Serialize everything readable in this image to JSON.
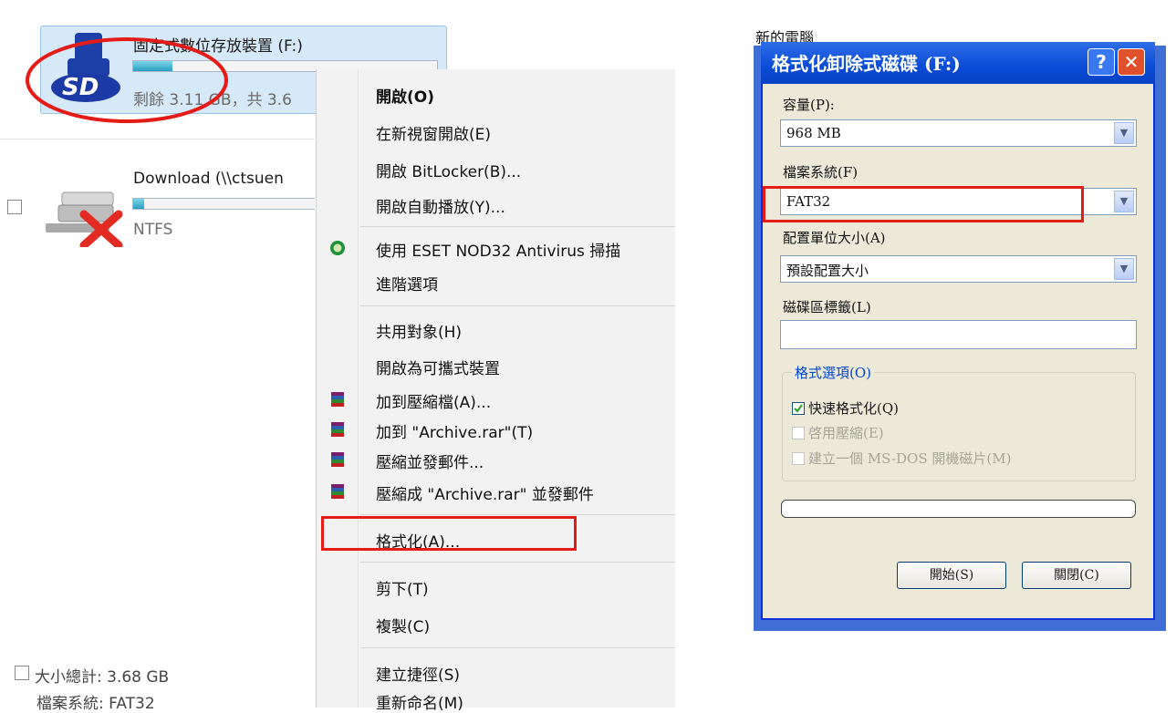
{
  "explorer": {
    "drive_sd": {
      "title": "固定式數位存放裝置 (F:)",
      "free_text": "剩餘 3.11 GB，共 3.6",
      "used_fraction": 0.13,
      "icon": "sd-card-icon"
    },
    "drive_network": {
      "title": "Download (\\\\ctsuen",
      "fs": "NTFS",
      "used_fraction": 0.06,
      "icon": "network-drive-disconnected-icon"
    },
    "details": {
      "size_label": "大小總計: 3.68 GB",
      "fs_label": "檔案系統: FAT32"
    }
  },
  "context_menu": {
    "items": [
      {
        "label": "開啟(O)",
        "bold": true
      },
      {
        "label": "在新視窗開啟(E)"
      },
      {
        "label": "開啟 BitLocker(B)..."
      },
      {
        "label": "開啟自動播放(Y)..."
      },
      {
        "label": "使用 ESET NOD32 Antivirus 掃描",
        "icon": "eset-icon"
      },
      {
        "label": "進階選項"
      },
      {
        "label": "共用對象(H)"
      },
      {
        "label": "開啟為可攜式裝置"
      },
      {
        "label": "加到壓縮檔(A)...",
        "icon": "winrar-icon"
      },
      {
        "label": "加到 \"Archive.rar\"(T)",
        "icon": "winrar-icon"
      },
      {
        "label": "壓縮並發郵件...",
        "icon": "winrar-icon"
      },
      {
        "label": "壓縮成 \"Archive.rar\" 並發郵件",
        "icon": "winrar-icon"
      },
      {
        "label": "格式化(A)...",
        "highlighted": true
      },
      {
        "label": "剪下(T)"
      },
      {
        "label": "複製(C)"
      },
      {
        "label": "建立捷徑(S)"
      },
      {
        "label": "重新命名(M)"
      }
    ]
  },
  "format_dialog": {
    "behind_label": "新的電腦",
    "title": "格式化卸除式磁碟 (F:)",
    "help_label": "?",
    "close_label": "✕",
    "capacity_label": "容量(P):",
    "capacity_value": "968 MB",
    "filesystem_label": "檔案系統(F)",
    "filesystem_value": "FAT32",
    "alloc_label": "配置單位大小(A)",
    "alloc_value": "預設配置大小",
    "volume_label": "磁碟區標籤(L)",
    "volume_value": "",
    "options_legend": "格式選項(O)",
    "quick_format": "快速格式化(Q)",
    "quick_format_checked": true,
    "compression": "啓用壓縮(E)",
    "msdos_disk": "建立一個 MS-DOS 開機磁片(M)",
    "progress": 0,
    "start_button": "開始(S)",
    "close_button": "關閉(C)"
  },
  "colors": {
    "highlight_red": "#e41b17",
    "xp_title_blue": "#0a4bd6",
    "dialog_face": "#ece9d8"
  }
}
